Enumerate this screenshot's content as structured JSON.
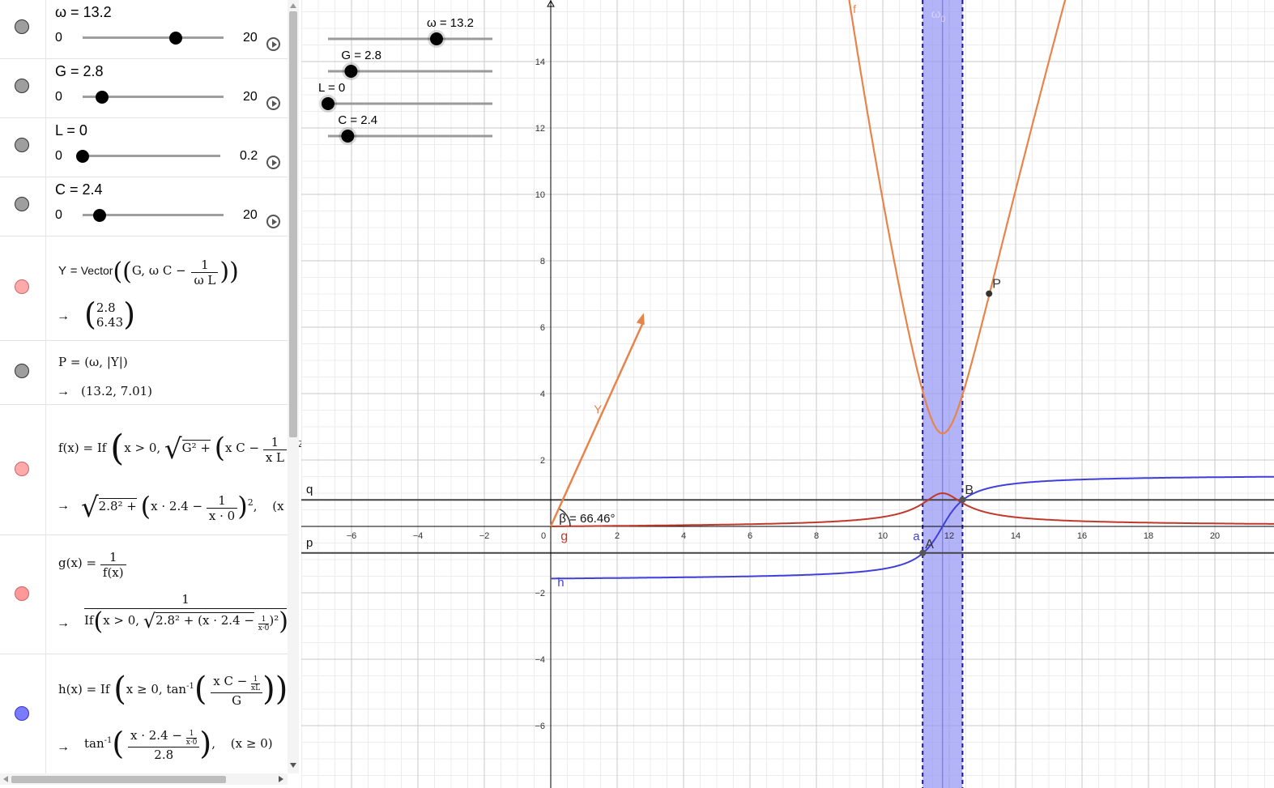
{
  "algebra": {
    "sliders": [
      {
        "label": "ω = 13.2",
        "min": "0",
        "max": "20",
        "value": 13.2,
        "range": [
          0,
          20
        ],
        "dot": "#9e9e9e"
      },
      {
        "label": "G = 2.8",
        "min": "0",
        "max": "20",
        "value": 2.8,
        "range": [
          0,
          20
        ],
        "dot": "#9e9e9e"
      },
      {
        "label": "L = 0",
        "min": "0",
        "max": "0.2",
        "value": 0,
        "range": [
          0,
          0.2
        ],
        "dot": "#9e9e9e"
      },
      {
        "label": "C = 2.4",
        "min": "0",
        "max": "20",
        "value": 2.4,
        "range": [
          0,
          20
        ],
        "dot": "#9e9e9e"
      }
    ],
    "Y": {
      "name": "Y",
      "vector_fn": "Vector",
      "args": "G, ω C −",
      "frac_num": "1",
      "frac_den": "ω L",
      "result_top": "2.8",
      "result_bottom": "6.43",
      "dot": "#ffaaaa"
    },
    "P": {
      "def": "P = (ω, |Y|)",
      "result": "(13.2, 7.01)",
      "dot": "#9e9e9e"
    },
    "f": {
      "def_lhs": "f(x) = If",
      "def_mid": "x > 0,",
      "def_root": "G² +",
      "def_paren": "x C −",
      "frac_num": "1",
      "frac_den": "x L",
      "exp": "2",
      "result_root": "2.8² +",
      "result_paren": "x · 2.4 −",
      "rfrac_num": "1",
      "rfrac_den": "x · 0",
      "rexp": "2",
      "result_tail": "(x >",
      "dot": "#ffaaaa"
    },
    "g": {
      "lhs": "g(x) =",
      "frac_num": "1",
      "frac_den": "f(x)",
      "result_num": "1",
      "result_den_if": "If",
      "result_den_mid": "x > 0,",
      "result_den_root": "2.8² + (x · 2.4 −",
      "rfrac_num": "1",
      "rfrac_den": "x·0",
      "result_den_close": ")²",
      "dot": "#ff9999"
    },
    "h": {
      "lhs": "h(x) = If",
      "mid": "x ≥ 0, tan",
      "inv": "-1",
      "frac_top": "x C −",
      "sfrac_num": "1",
      "sfrac_den": "xL",
      "frac_bottom": "G",
      "result_fn": "tan",
      "result_inv": "-1",
      "rfrac_top": "x · 2.4 −",
      "rsfrac_num": "1",
      "rsfrac_den": "x·0",
      "rfrac_bottom": "2.8",
      "result_cond": "(x ≥ 0)",
      "dot": "#7b7bff"
    }
  },
  "graphics": {
    "overlay_sliders": [
      {
        "label": "ω = 13.2",
        "value": 13.2,
        "range": [
          0,
          20
        ]
      },
      {
        "label": "G = 2.8",
        "value": 2.8,
        "range": [
          0,
          20
        ]
      },
      {
        "label": "L = 0",
        "value": 0,
        "range": [
          0,
          0.2
        ]
      },
      {
        "label": "C = 2.4",
        "value": 2.4,
        "range": [
          0,
          20
        ]
      }
    ],
    "x_ticks": [
      "−6",
      "−4",
      "−2",
      "0",
      "2",
      "4",
      "6",
      "8",
      "10",
      "12",
      "14",
      "16",
      "18",
      "20"
    ],
    "y_ticks": [
      "14",
      "12",
      "10",
      "8",
      "6",
      "4",
      "2",
      "−2",
      "−4",
      "−6"
    ],
    "labels": {
      "f": "f",
      "g": "g",
      "h": "h",
      "Y": "Y",
      "P": "P",
      "A": "A",
      "B": "B",
      "a": "a",
      "p": "p",
      "q": "q",
      "omega0": "ω",
      "omega0_sub": "0",
      "beta": "β = 66.46°"
    },
    "params": {
      "G": 2.8,
      "C": 2.4,
      "omega": 13.2,
      "band": [
        11.2,
        12.4
      ],
      "q_y": 0.8,
      "p_y": -0.8
    },
    "colors": {
      "f": "#e8844a",
      "g": "#c0392b",
      "h": "#3f3fd9",
      "band_fill": "#9a9af5",
      "axis": "#000000",
      "grid_major": "#c8c8c8",
      "grid_minor": "#ececec",
      "hline": "#444444"
    },
    "points": {
      "P": [
        13.2,
        7.01
      ],
      "A": [
        11.2,
        -0.8
      ],
      "B": [
        12.4,
        0.8
      ]
    },
    "vector_Y": [
      2.8,
      6.43
    ]
  }
}
